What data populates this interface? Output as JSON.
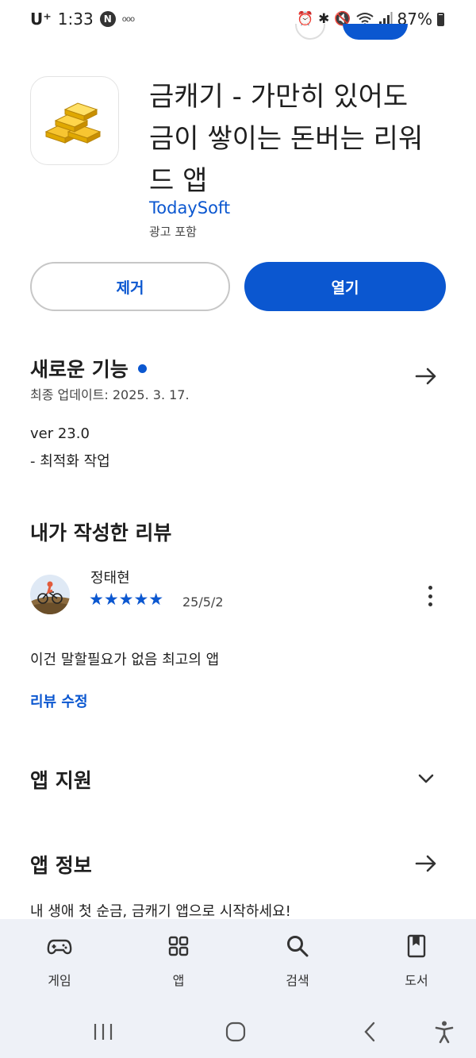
{
  "status_bar": {
    "carrier": "U⁺",
    "time": "1:33",
    "battery": "87%"
  },
  "app": {
    "title_line1": "금캐기 - 가만히 있어도",
    "title_line2": "금이 쌓이는 돈버는 리워",
    "title_line3": "드 앱",
    "developer": "TodaySoft",
    "ads_note": "광고 포함"
  },
  "actions": {
    "remove_label": "제거",
    "open_label": "열기"
  },
  "whats_new": {
    "title": "새로운 기능",
    "last_updated": "최종 업데이트: 2025. 3. 17.",
    "version": "ver 23.0",
    "note": "- 최적화 작업"
  },
  "my_review": {
    "title": "내가 작성한 리뷰",
    "reviewer": "정태현",
    "rating": 5,
    "stars": "★★★★★",
    "date": "25/5/2",
    "text": "이건 말할필요가 없음 최고의 앱",
    "edit_label": "리뷰 수정"
  },
  "app_support": {
    "title": "앱 지원"
  },
  "app_info": {
    "title": "앱 정보",
    "description": "내 생애 첫 순금, 금캐기 앱으로 시작하세요!"
  },
  "bottom_nav": {
    "items": [
      {
        "label": "게임",
        "icon": "gamepad-icon"
      },
      {
        "label": "앱",
        "icon": "apps-grid-icon"
      },
      {
        "label": "검색",
        "icon": "search-icon"
      },
      {
        "label": "도서",
        "icon": "book-icon"
      }
    ]
  },
  "colors": {
    "accent": "#0b57d0",
    "nav_background": "#eef1f7"
  }
}
